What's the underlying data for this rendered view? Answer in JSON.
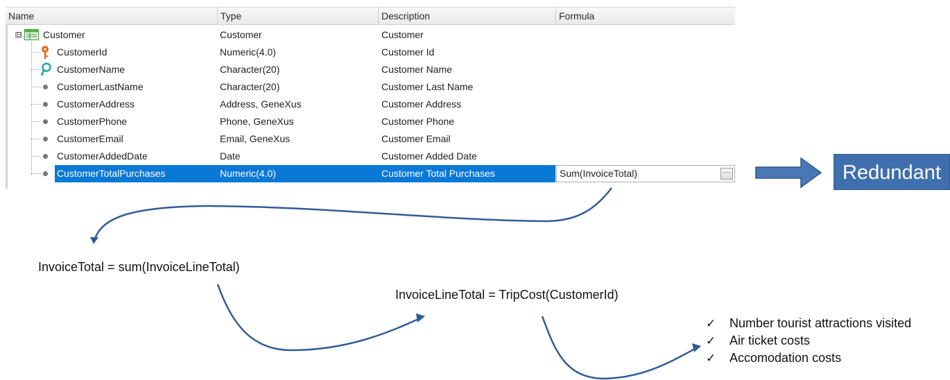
{
  "grid": {
    "columns": [
      "Name",
      "Type",
      "Description",
      "Formula"
    ],
    "root": {
      "name": "Customer",
      "type": "Customer",
      "description": "Customer",
      "icon": "transaction-table-icon",
      "expander": "⊟"
    },
    "rows": [
      {
        "name": "CustomerId",
        "type": "Numeric(4.0)",
        "description": "Customer Id",
        "formula": "",
        "icon": "primary-key-icon"
      },
      {
        "name": "CustomerName",
        "type": "Character(20)",
        "description": "Customer Name",
        "formula": "",
        "icon": "description-key-icon"
      },
      {
        "name": "CustomerLastName",
        "type": "Character(20)",
        "description": "Customer Last Name",
        "formula": "",
        "icon": "bullet-icon"
      },
      {
        "name": "CustomerAddress",
        "type": "Address, GeneXus",
        "description": "Customer Address",
        "formula": "",
        "icon": "bullet-icon"
      },
      {
        "name": "CustomerPhone",
        "type": "Phone, GeneXus",
        "description": "Customer Phone",
        "formula": "",
        "icon": "bullet-icon"
      },
      {
        "name": "CustomerEmail",
        "type": "Email, GeneXus",
        "description": "Customer Email",
        "formula": "",
        "icon": "bullet-icon"
      },
      {
        "name": "CustomerAddedDate",
        "type": "Date",
        "description": "Customer Added Date",
        "formula": "",
        "icon": "bullet-icon"
      },
      {
        "name": "CustomerTotalPurchases",
        "type": "Numeric(4.0)",
        "description": "Customer Total Purchases",
        "formula": "Sum(InvoiceTotal)",
        "icon": "bullet-icon",
        "selected": true,
        "ellipsis": "···"
      }
    ]
  },
  "annotations": {
    "redundant_label": "Redundant",
    "formula1": "InvoiceTotal = sum(InvoiceLineTotal)",
    "formula2": "InvoiceLineTotal = TripCost(CustomerId)",
    "check_mark": "✓",
    "checklist": [
      "Number tourist attractions visited",
      "Air ticket costs",
      "Accomodation costs"
    ]
  },
  "colors": {
    "selection": "#0a78d7",
    "arrow_fill": "#4a78b5",
    "arrow_stroke": "#2c5891",
    "curve_stroke": "#2f5c97",
    "redundant_bg": "#3f6fae",
    "key_orange": "#e46b1f",
    "key_teal": "#17a6b5"
  }
}
